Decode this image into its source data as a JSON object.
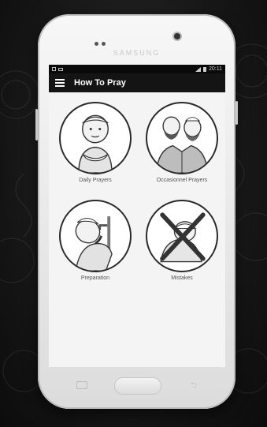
{
  "device": {
    "brand": "SAMSUNG"
  },
  "status_bar": {
    "time": "20:11"
  },
  "app_bar": {
    "title": "How To Pray",
    "menu_icon": "hamburger-menu-icon"
  },
  "tiles": [
    {
      "label": "Daily Prayers",
      "icon": "praying-boy-illustration"
    },
    {
      "label": "Occasionnel Prayers",
      "icon": "two-men-embracing-illustration"
    },
    {
      "label": "Preparation",
      "icon": "boy-washing-illustration"
    },
    {
      "label": "Mistakes",
      "icon": "crossed-out-prayer-illustration"
    }
  ],
  "nav_bar": {
    "buttons": [
      "recent-apps-icon",
      "home-button",
      "back-icon"
    ]
  },
  "colors": {
    "app_bar": "#141414",
    "screen_bg": "#f4f4f4",
    "status_bar": "#0a0a0a"
  }
}
